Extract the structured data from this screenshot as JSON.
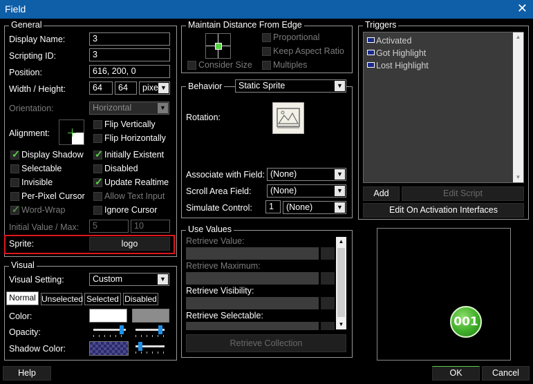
{
  "window": {
    "title": "Field",
    "close_glyph": "✕"
  },
  "general": {
    "legend": "General",
    "display_name": {
      "label": "Display Name:",
      "value": "3"
    },
    "scripting_id": {
      "label": "Scripting ID:",
      "value": "3"
    },
    "position": {
      "label": "Position:",
      "value": "616, 200, 0"
    },
    "size": {
      "label": "Width / Height:",
      "width": "64",
      "height": "64",
      "unit": "pixe"
    },
    "orientation": {
      "label": "Orientation:",
      "value": "Horizontal"
    },
    "alignment": {
      "label": "Alignment:"
    },
    "flip_vertically": {
      "label": "Flip Vertically",
      "checked": false
    },
    "flip_horizontally": {
      "label": "Flip Horizontally",
      "checked": false
    },
    "display_shadow": {
      "label": "Display Shadow",
      "checked": true
    },
    "initially_existent": {
      "label": "Initially Existent",
      "checked": true
    },
    "selectable": {
      "label": "Selectable",
      "checked": false
    },
    "disabled": {
      "label": "Disabled",
      "checked": false
    },
    "invisible": {
      "label": "Invisible",
      "checked": false
    },
    "update_realtime": {
      "label": "Update Realtime",
      "checked": true
    },
    "per_pixel_cursor": {
      "label": "Per-Pixel Cursor",
      "checked": false
    },
    "allow_text_input": {
      "label": "Allow Text Input",
      "checked": false
    },
    "word_wrap": {
      "label": "Word-Wrap",
      "checked": true
    },
    "ignore_cursor": {
      "label": "Ignore Cursor",
      "checked": false
    },
    "initial_value": {
      "label": "Initial Value / Max:",
      "value": "5",
      "max": "10"
    },
    "sprite": {
      "label": "Sprite:",
      "value": "logo"
    }
  },
  "visual": {
    "legend": "Visual",
    "setting": {
      "label": "Visual Setting:",
      "value": "Custom"
    },
    "tabs": [
      "Normal",
      "Unselected",
      "Selected",
      "Disabled"
    ],
    "color_label": "Color:",
    "opacity_label": "Opacity:",
    "shadow_color_label": "Shadow Color:"
  },
  "distance": {
    "legend": "Maintain Distance From Edge",
    "proportional": "Proportional",
    "keep_aspect": "Keep Aspect Ratio",
    "consider_size": "Consider Size",
    "multiples": "Multiples"
  },
  "behavior": {
    "legend": "Behavior",
    "type": "Static Sprite",
    "rotation_label": "Rotation:",
    "associate": {
      "label": "Associate with Field:",
      "value": "(None)"
    },
    "scroll_area": {
      "label": "Scroll Area Field:",
      "value": "(None)"
    },
    "simulate": {
      "label": "Simulate Control:",
      "number": "1",
      "value": "(None)"
    }
  },
  "use_values": {
    "legend": "Use Values",
    "rows": [
      {
        "label": "Retrieve Value:",
        "enabled": false
      },
      {
        "label": "Retrieve Maximum:",
        "enabled": false
      },
      {
        "label": "Retrieve Visibility:",
        "enabled": true
      },
      {
        "label": "Retrieve Selectable:",
        "enabled": true
      }
    ],
    "collection_button": "Retrieve Collection"
  },
  "triggers": {
    "legend": "Triggers",
    "items": [
      "Activated",
      "Got Highlight",
      "Lost Highlight"
    ],
    "add_button": "Add",
    "edit_script_button": "Edit Script",
    "edit_interfaces_button": "Edit On Activation Interfaces"
  },
  "preview": {
    "badge_text": "001"
  },
  "footer": {
    "help": "Help",
    "ok": "OK",
    "cancel": "Cancel"
  },
  "colors": {
    "title_bar": "#0f5ea8",
    "check": "#5cd14a",
    "highlight_border": "#e0161c",
    "badge": "#3fae2a"
  }
}
